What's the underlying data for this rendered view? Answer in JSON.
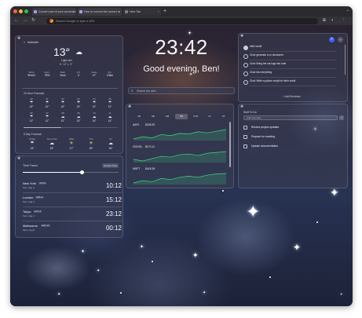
{
  "browser": {
    "tabs": [
      {
        "title": "Convert part of your screensh",
        "active": false
      },
      {
        "title": "How to convert the screen re",
        "active": false
      },
      {
        "title": "New Tab",
        "active": true
      }
    ],
    "new_tab_glyph": "+",
    "omnibox_placeholder": "Search Google or type a URL",
    "colors": {
      "close": "#ff5f57",
      "minimize": "#febc2e",
      "maximize": "#28c840",
      "tab_strip": "#2a2a2f",
      "toolbar": "#323238"
    }
  },
  "clock": {
    "time": "23:42",
    "greeting": "Good evening, Ben!"
  },
  "search": {
    "placeholder": "Search the web..."
  },
  "weather": {
    "location": "Adelaide",
    "temperature": "13°",
    "condition": "Light rain",
    "hilo": "H: 14° L: 9°",
    "stats": [
      {
        "label": "Wind",
        "value": "9km/h"
      },
      {
        "label": "Hum.",
        "value": "78%"
      },
      {
        "label": "Rain",
        "value": "2mm"
      },
      {
        "label": "UV",
        "value": "0"
      },
      {
        "label": "Feels",
        "value": "11°"
      },
      {
        "label": "Vis.",
        "value": "10km"
      }
    ],
    "hourly_title": "24 Hour Forecast",
    "hourly": [
      {
        "time": "00",
        "icon": "rain-icon",
        "temp": "13°"
      },
      {
        "time": "01",
        "icon": "rain-icon",
        "temp": "12°"
      },
      {
        "time": "02",
        "icon": "rain-icon",
        "temp": "12°"
      },
      {
        "time": "03",
        "icon": "rain-icon",
        "temp": "12°"
      },
      {
        "time": "04",
        "icon": "rain-icon",
        "temp": "11°"
      },
      {
        "time": "05",
        "icon": "rain-icon",
        "temp": "11°"
      },
      {
        "time": "06",
        "icon": "rain-icon",
        "temp": "11°"
      },
      {
        "time": "07",
        "icon": "rain-icon",
        "temp": "11°"
      },
      {
        "time": "08",
        "icon": "cloud-icon",
        "temp": "12°"
      },
      {
        "time": "09",
        "icon": "cloud-icon",
        "temp": "13°"
      },
      {
        "time": "10",
        "icon": "cloud-icon",
        "temp": "14°"
      },
      {
        "time": "11",
        "icon": "cloud-icon",
        "temp": "14°"
      }
    ],
    "daily_title": "5 Day Forecast",
    "daily": [
      {
        "day": "Today",
        "icon": "rain-icon",
        "temp": "14°"
      },
      {
        "day": "Tomorrow",
        "icon": "cloud-icon",
        "temp": "15°"
      },
      {
        "day": "Wed",
        "icon": "sun-icon",
        "temp": "17°"
      },
      {
        "day": "Thu",
        "icon": "sun-icon",
        "temp": "18°"
      },
      {
        "day": "Fri",
        "icon": "cloud-icon",
        "temp": "16°"
      }
    ]
  },
  "timezones": {
    "title": "Time Travel",
    "button_label": "Current Time",
    "slider_level": 0.62,
    "rows": [
      {
        "city": "New York",
        "badge": "GMT-4",
        "date": "Sun, Aug 4",
        "time": "10:12"
      },
      {
        "city": "London",
        "badge": "GMT+1",
        "date": "Sun, Aug 4",
        "time": "15:12"
      },
      {
        "city": "Tokyo",
        "badge": "GMT+9",
        "date": "Sun, Aug 4",
        "time": "23:12"
      },
      {
        "city": "Melbourne",
        "badge": "GMT+10",
        "date": "Mon, Aug 5",
        "time": "00:12"
      }
    ]
  },
  "stocks": {
    "ranges": [
      "1D",
      "5D",
      "1M",
      "6M",
      "YTD",
      "1Y",
      "5Y"
    ],
    "active_range": 3,
    "tickers": [
      {
        "symbol": "AAPL",
        "price": "$226.92",
        "values": [
          210,
          214,
          212,
          218,
          216,
          220,
          219,
          223,
          221,
          224,
          226.92
        ]
      },
      {
        "symbol": "GOOGL",
        "price": "$170.11",
        "values": [
          160,
          158,
          161,
          164,
          163,
          166,
          167,
          165,
          168,
          169,
          170.11
        ]
      },
      {
        "symbol": "MSFT",
        "price": "$418.35",
        "values": [
          410,
          412,
          411,
          414,
          413,
          415,
          416,
          415,
          417,
          418,
          418.35
        ]
      }
    ],
    "color": "#3ddc84"
  },
  "reminders": {
    "items": [
      {
        "text": "hello world",
        "done": true
      },
      {
        "text": "Chat: generate a cv document",
        "done": false
      },
      {
        "text": "Chat: Bring the cat logs into chat",
        "done": false
      },
      {
        "text": "Chat: list everything",
        "done": false
      },
      {
        "text": "Chat: Write a python script for hello world",
        "done": false
      }
    ],
    "footer": "+ Add Reminder"
  },
  "todo": {
    "title": "Stuff To Do",
    "add_label": "Add new task...",
    "items": [
      {
        "text": "Review project updates"
      },
      {
        "text": "Prepare for meeting"
      },
      {
        "text": "Update documentation"
      }
    ]
  }
}
